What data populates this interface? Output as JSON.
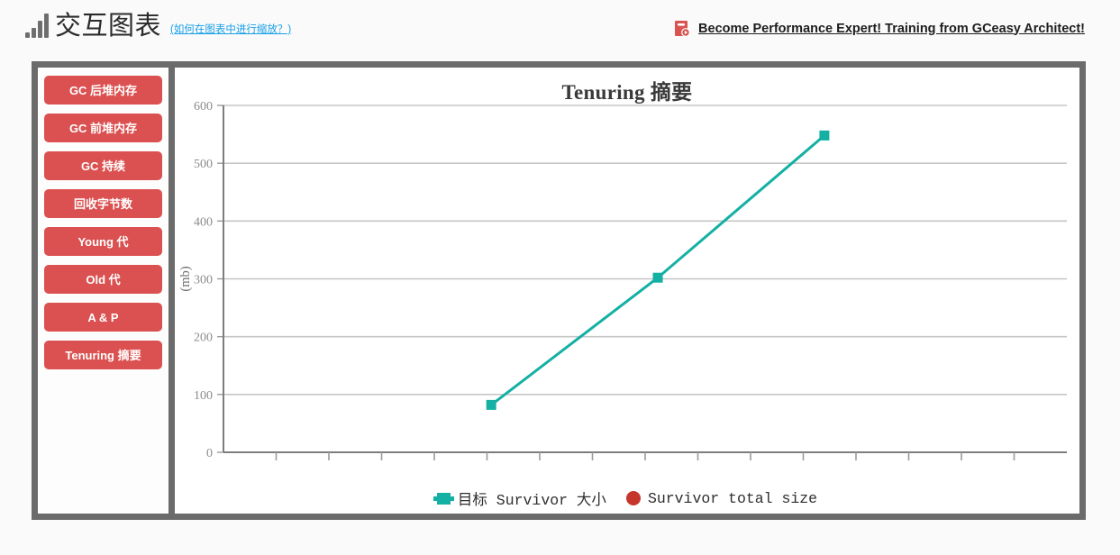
{
  "header": {
    "logo_icon": "bar-chart-logo-icon",
    "title": "交互图表",
    "help_link": "(如何在图表中进行缩放？)",
    "promo_icon": "video-book-icon",
    "promo_link": "Become Performance Expert! Training from GCeasy Architect!"
  },
  "sidebar": {
    "items": [
      {
        "label": "GC 后堆内存",
        "name": "sidebar-item-gc-heap-after"
      },
      {
        "label": "GC 前堆内存",
        "name": "sidebar-item-gc-heap-before"
      },
      {
        "label": "GC 持续",
        "name": "sidebar-item-gc-duration"
      },
      {
        "label": "回收字节数",
        "name": "sidebar-item-reclaimed-bytes"
      },
      {
        "label": "Young 代",
        "name": "sidebar-item-young-gen"
      },
      {
        "label": "Old 代",
        "name": "sidebar-item-old-gen"
      },
      {
        "label": "A & P",
        "name": "sidebar-item-a-and-p"
      },
      {
        "label": "Tenuring 摘要",
        "name": "sidebar-item-tenuring-summary"
      }
    ]
  },
  "colors": {
    "accent_red": "#db5151",
    "frame_gray": "#6b6b6b",
    "series_teal": "#14b0a4",
    "series_red": "#c5372c",
    "link_blue": "#18a0e8"
  },
  "chart_data": {
    "type": "line",
    "title": "Tenuring 摘要",
    "xlabel": "",
    "ylabel": "(mb)",
    "ylim": [
      0,
      600
    ],
    "yticks": [
      0,
      100,
      200,
      300,
      400,
      500,
      600
    ],
    "ytick_labels": [
      "0",
      "100",
      "200",
      "300",
      "400",
      "500",
      "600"
    ],
    "grid": true,
    "legend_position": "bottom",
    "x_tick_count": 15,
    "x_tick_labels": [],
    "series": [
      {
        "name": "目标 Survivor 大小",
        "color": "#14b0a4",
        "marker": "square",
        "x": [
          1,
          2,
          3
        ],
        "values": [
          82,
          302,
          548
        ]
      },
      {
        "name": "Survivor total size",
        "color": "#c5372c",
        "marker": "circle",
        "x": [],
        "values": []
      }
    ]
  }
}
